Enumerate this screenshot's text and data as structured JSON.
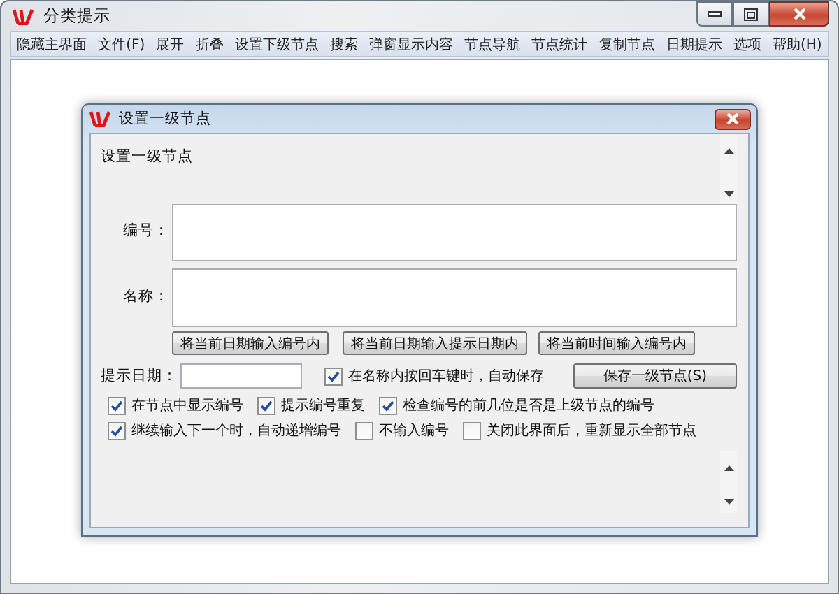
{
  "window": {
    "title": "分类提示"
  },
  "menu": [
    "隐藏主界面",
    "文件(F)",
    "展开",
    "折叠",
    "设置下级节点",
    "搜索",
    "弹窗显示内容",
    "节点导航",
    "节点统计",
    "复制节点",
    "日期提示",
    "选项",
    "帮助(H)"
  ],
  "dialog": {
    "title": "设置一级节点",
    "heading": "设置一级节点",
    "fields": [
      {
        "label": "编号："
      },
      {
        "label": "名称："
      }
    ],
    "buttons": [
      "将当前日期输入编号内",
      "将当前日期输入提示日期内",
      "将当前时间输入编号内"
    ],
    "date_field": {
      "label": "提示日期："
    },
    "auto_save": {
      "label": "在名称内按回车键时，自动保存",
      "checked": true
    },
    "save_button": "保存一级节点(S)",
    "option_rows": [
      [
        {
          "label": "在节点中显示编号",
          "checked": true
        },
        {
          "label": "提示编号重复",
          "checked": true
        },
        {
          "label": "检查编号的前几位是否是上级节点的编号",
          "checked": true
        }
      ],
      [
        {
          "label": "继续输入下一个时，自动递增编号",
          "checked": true
        },
        {
          "label": "不输入编号",
          "checked": false
        },
        {
          "label": "关闭此界面后，重新显示全部节点",
          "checked": false
        }
      ]
    ]
  }
}
